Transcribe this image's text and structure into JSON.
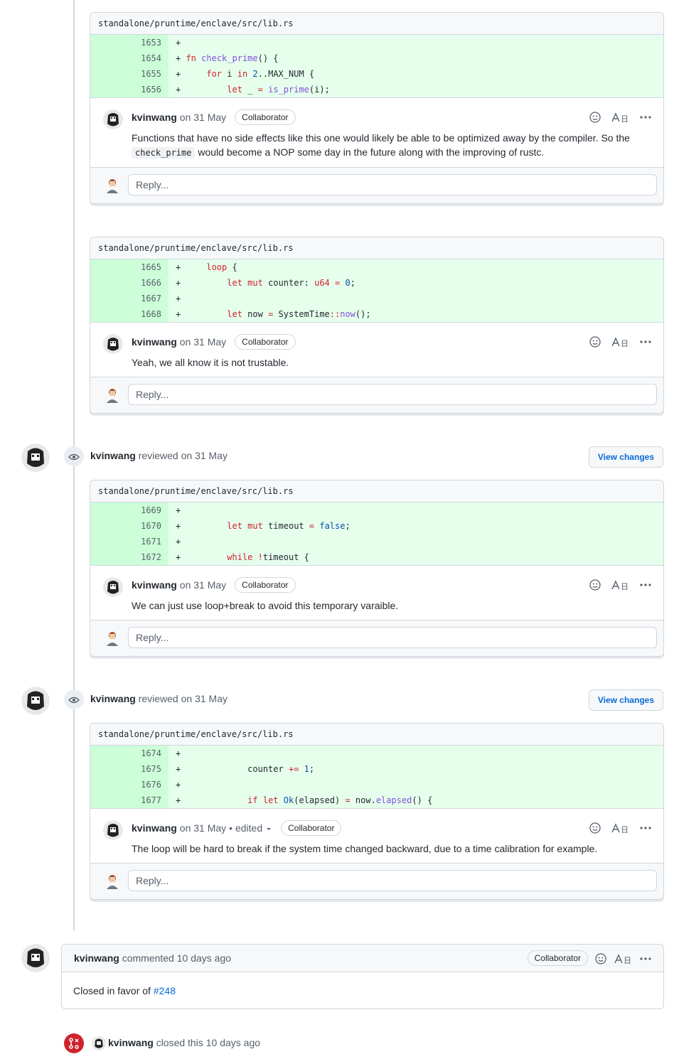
{
  "threads": [
    {
      "path": "standalone/pruntime/enclave/src/lib.rs",
      "lines": [
        "1653",
        "1654",
        "1655",
        "1656"
      ],
      "author": "kvinwang",
      "when": "on 31 May",
      "badge": "Collaborator",
      "body_a": "Functions that have no side effects like this one would likely be able to be optimized away by the compiler. So the ",
      "body_code": "check_prime",
      "body_b": " would become a NOP some day in the future along with the improving of rustc.",
      "reply": "Reply..."
    },
    {
      "path": "standalone/pruntime/enclave/src/lib.rs",
      "lines": [
        "1665",
        "1666",
        "1667",
        "1668"
      ],
      "author": "kvinwang",
      "when": "on 31 May",
      "badge": "Collaborator",
      "body": "Yeah, we all know it is not trustable.",
      "reply": "Reply..."
    },
    {
      "path": "standalone/pruntime/enclave/src/lib.rs",
      "lines": [
        "1669",
        "1670",
        "1671",
        "1672"
      ],
      "author": "kvinwang",
      "when": "on 31 May",
      "badge": "Collaborator",
      "body": "We can just use loop+break to avoid this temporary varaible.",
      "reply": "Reply..."
    },
    {
      "path": "standalone/pruntime/enclave/src/lib.rs",
      "lines": [
        "1674",
        "1675",
        "1676",
        "1677"
      ],
      "author": "kvinwang",
      "when": "on 31 May",
      "edited": "• edited",
      "badge": "Collaborator",
      "body": "The loop will be hard to break if the system time changed backward, due to a time calibration for example.",
      "reply": "Reply..."
    }
  ],
  "reviews": [
    {
      "author": "kvinwang",
      "action": "reviewed",
      "when": "on 31 May",
      "button": "View changes"
    },
    {
      "author": "kvinwang",
      "action": "reviewed",
      "when": "on 31 May",
      "button": "View changes"
    }
  ],
  "final_comment": {
    "author": "kvinwang",
    "action": "commented",
    "when": "10 days ago",
    "badge": "Collaborator",
    "text": "Closed in favor of ",
    "link": "#248"
  },
  "closed_event": {
    "author": "kvinwang",
    "text": "closed this",
    "when": "10 days ago"
  },
  "icons": {
    "smiley": "smiley-icon",
    "translate": "translate-icon",
    "kebab": "kebab-icon",
    "eye": "eye-icon",
    "closed": "pr-closed-icon"
  },
  "colors": {
    "added_bg": "#e6ffec",
    "added_ln_bg": "#ccffd8",
    "closed_red": "#cf222e",
    "link": "#0969da"
  }
}
